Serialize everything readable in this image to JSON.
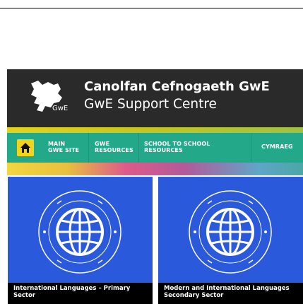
{
  "header": {
    "title": "Canolfan Cefnogaeth GwE",
    "subtitle": "GwE Support Centre",
    "logo_text": "GwE"
  },
  "nav": {
    "home_icon": "home-icon",
    "items": [
      {
        "line1": "MAIN",
        "line2": "GWE SITE"
      },
      {
        "line1": "GWE",
        "line2": "RESOURCES"
      },
      {
        "line1": "SCHOOL TO SCHOOL",
        "line2": "RESOURCES"
      },
      {
        "line1": "CYMRAEG",
        "line2": ""
      }
    ]
  },
  "cards": [
    {
      "caption_line1": "International Languages – Primary",
      "caption_line2": "Sector"
    },
    {
      "caption_line1": "Modern and International Languages",
      "caption_line2": "Secondary Sector"
    }
  ],
  "colors": {
    "header_bg": "#2a2a2a",
    "nav_bg": "#23a889",
    "home_bg": "#f2d51b",
    "card_bg": "#2b59dc"
  }
}
